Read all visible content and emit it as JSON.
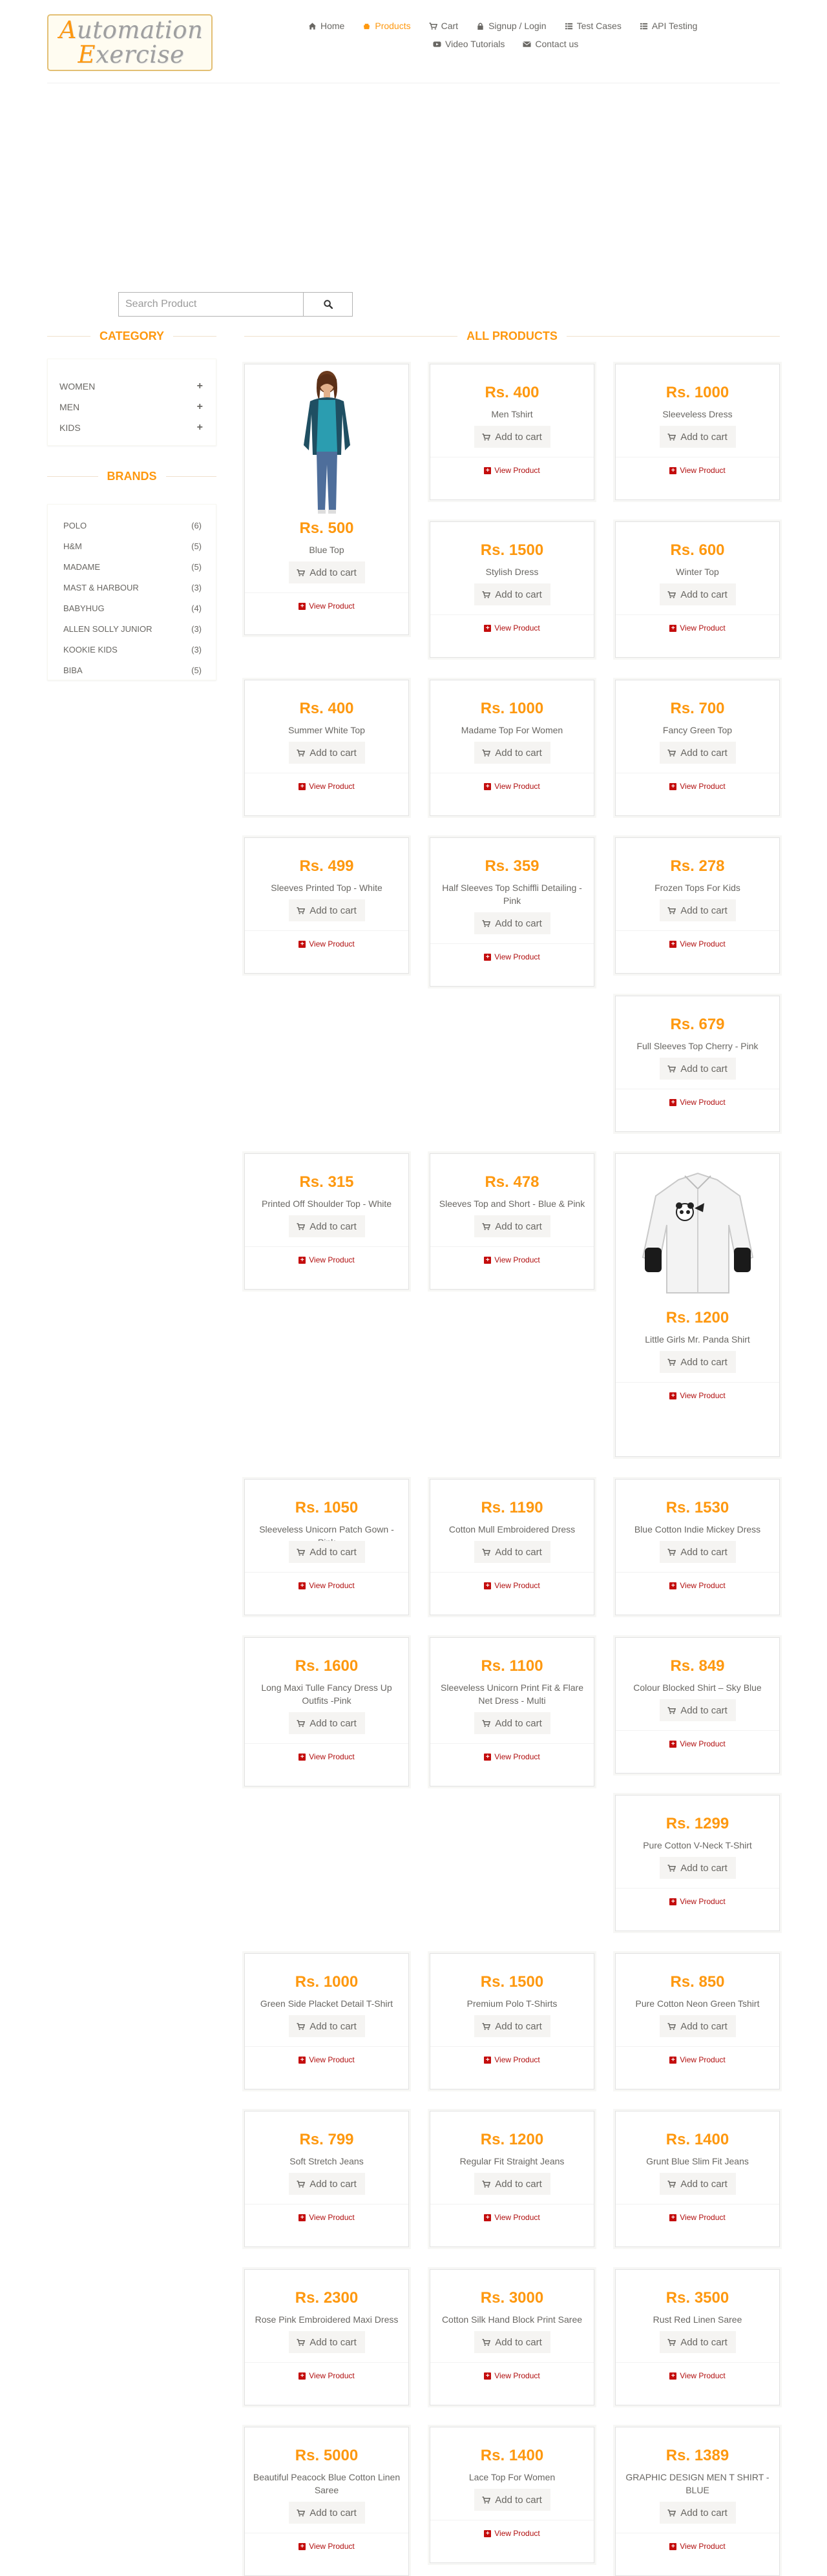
{
  "logo": {
    "first": "Automation",
    "second": "Exercise"
  },
  "nav": [
    {
      "label": "Home",
      "icon": "home-icon",
      "active": false
    },
    {
      "label": "Products",
      "icon": "products-icon",
      "active": true
    },
    {
      "label": "Cart",
      "icon": "cart-icon",
      "active": false
    },
    {
      "label": "Signup / Login",
      "icon": "lock-icon",
      "active": false
    },
    {
      "label": "Test Cases",
      "icon": "list-icon",
      "active": false
    },
    {
      "label": "API Testing",
      "icon": "list-icon",
      "active": false
    },
    {
      "label": "Video Tutorials",
      "icon": "youtube-icon",
      "active": false
    },
    {
      "label": "Contact us",
      "icon": "envelope-icon",
      "active": false
    }
  ],
  "search": {
    "placeholder": "Search Product",
    "value": ""
  },
  "sidebar": {
    "category_title": "Category",
    "categories": [
      "Women",
      "Men",
      "Kids"
    ],
    "brands_title": "Brands",
    "brands": [
      {
        "name": "Polo",
        "count": "(6)"
      },
      {
        "name": "H&M",
        "count": "(5)"
      },
      {
        "name": "Madame",
        "count": "(5)"
      },
      {
        "name": "Mast & Harbour",
        "count": "(3)"
      },
      {
        "name": "Babyhug",
        "count": "(4)"
      },
      {
        "name": "Allen Solly Junior",
        "count": "(3)"
      },
      {
        "name": "Kookie Kids",
        "count": "(3)"
      },
      {
        "name": "Biba",
        "count": "(5)"
      }
    ]
  },
  "products_title": "All Products",
  "add_to_cart_label": "Add to cart",
  "view_product_label": "View Product",
  "products": [
    {
      "price": "Rs. 500",
      "name": "Blue Top",
      "image": "woman-in-blue-top"
    },
    {
      "price": "Rs. 400",
      "name": "Men Tshirt"
    },
    {
      "price": "Rs. 1000",
      "name": "Sleeveless Dress"
    },
    {
      "price": "Rs. 1500",
      "name": "Stylish Dress"
    },
    {
      "price": "Rs. 600",
      "name": "Winter Top"
    },
    {
      "price": "Rs. 400",
      "name": "Summer White Top"
    },
    {
      "price": "Rs. 1000",
      "name": "Madame Top For Women"
    },
    {
      "price": "Rs. 700",
      "name": "Fancy Green Top"
    },
    {
      "price": "Rs. 499",
      "name": "Sleeves Printed Top - White"
    },
    {
      "price": "Rs. 359",
      "name": "Half Sleeves Top Schiffli Detailing - Pink"
    },
    {
      "price": "Rs. 278",
      "name": "Frozen Tops For Kids"
    },
    {
      "price": "Rs. 679",
      "name": "Full Sleeves Top Cherry - Pink"
    },
    {
      "price": "Rs. 315",
      "name": "Printed Off Shoulder Top - White"
    },
    {
      "price": "Rs. 478",
      "name": "Sleeves Top and Short - Blue & Pink"
    },
    {
      "price": "Rs. 1200",
      "name": "Little Girls Mr. Panda Shirt",
      "image": "white-panda-shirt"
    },
    {
      "price": "Rs. 1050",
      "name": "Sleeveless Unicorn Patch Gown - Pink"
    },
    {
      "price": "Rs. 1190",
      "name": "Cotton Mull Embroidered Dress"
    },
    {
      "price": "Rs. 1530",
      "name": "Blue Cotton Indie Mickey Dress"
    },
    {
      "price": "Rs. 1600",
      "name": "Long Maxi Tulle Fancy Dress Up Outfits -Pink"
    },
    {
      "price": "Rs. 1100",
      "name": "Sleeveless Unicorn Print Fit & Flare Net Dress - Multi"
    },
    {
      "price": "Rs. 849",
      "name": "Colour Blocked Shirt – Sky Blue"
    },
    {
      "price": "Rs. 1299",
      "name": "Pure Cotton V-Neck T-Shirt"
    },
    {
      "price": "Rs. 1000",
      "name": "Green Side Placket Detail T-Shirt"
    },
    {
      "price": "Rs. 1500",
      "name": "Premium Polo T-Shirts"
    },
    {
      "price": "Rs. 850",
      "name": "Pure Cotton Neon Green Tshirt"
    },
    {
      "price": "Rs. 799",
      "name": "Soft Stretch Jeans"
    },
    {
      "price": "Rs. 1200",
      "name": "Regular Fit Straight Jeans"
    },
    {
      "price": "Rs. 1400",
      "name": "Grunt Blue Slim Fit Jeans"
    },
    {
      "price": "Rs. 2300",
      "name": "Rose Pink Embroidered Maxi Dress"
    },
    {
      "price": "Rs. 3000",
      "name": "Cotton Silk Hand Block Print Saree"
    },
    {
      "price": "Rs. 3500",
      "name": "Rust Red Linen Saree"
    },
    {
      "price": "Rs. 5000",
      "name": "Beautiful Peacock Blue Cotton Linen Saree"
    },
    {
      "price": "Rs. 1400",
      "name": "Lace Top For Women"
    },
    {
      "price": "Rs. 1389",
      "name": "GRAPHIC DESIGN MEN T SHIRT - BLUE"
    }
  ],
  "colors": {
    "accent": "#FE980F",
    "link": "#B00E0E",
    "text": "#696763"
  }
}
